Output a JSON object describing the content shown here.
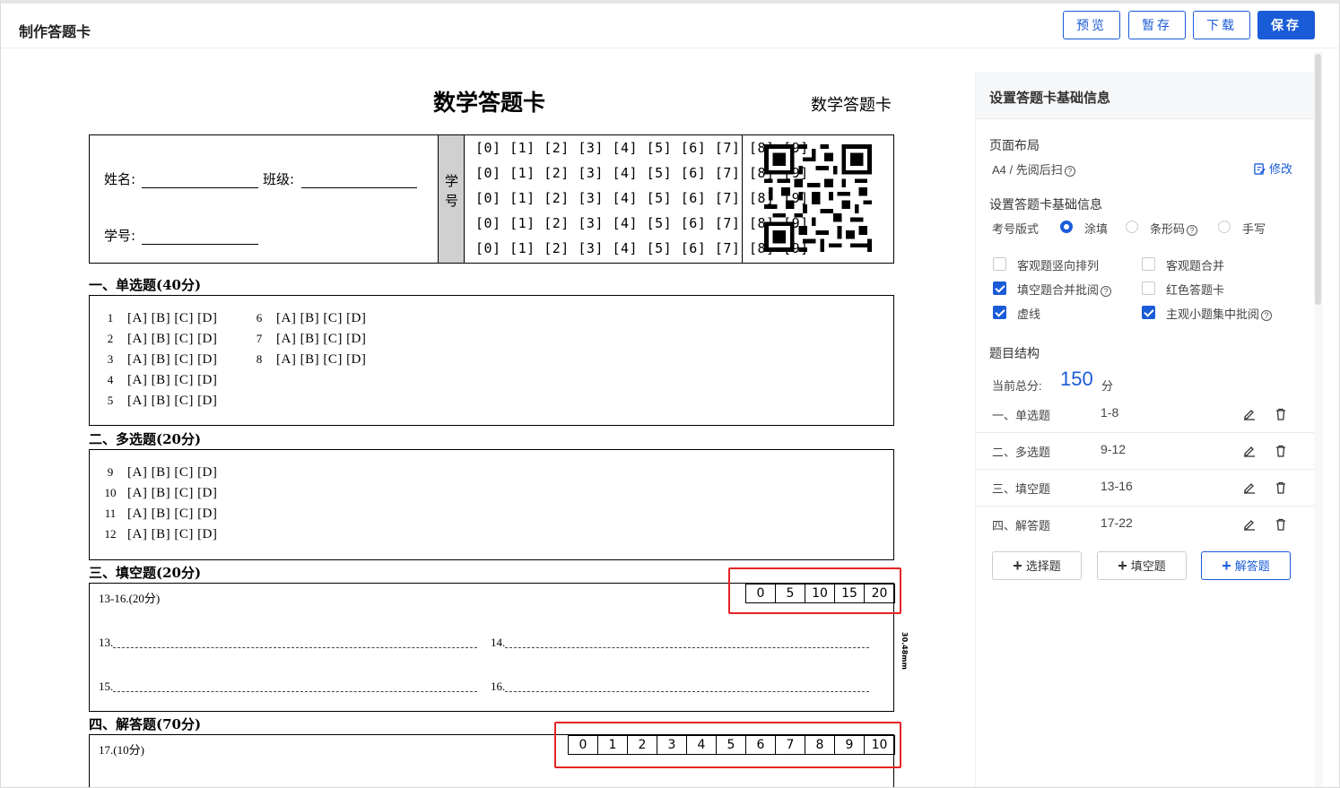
{
  "header": {
    "title": "制作答题卡",
    "buttons": {
      "preview": "预览",
      "draft": "暂存",
      "download": "下载",
      "save": "保存"
    }
  },
  "sheet": {
    "title": "数学答题卡",
    "subtitle": "数学答题卡",
    "info": {
      "name_label": "姓名:",
      "class_label": "班级:",
      "id_label": "学号:",
      "column_label": "学号",
      "digit_rows": [
        "[0] [1] [2] [3] [4] [5] [6] [7] [8] [9]",
        "[0] [1] [2] [3] [4] [5] [6] [7] [8] [9]",
        "[0] [1] [2] [3] [4] [5] [6] [7] [8] [9]",
        "[0] [1] [2] [3] [4] [5] [6] [7] [8] [9]",
        "[0] [1] [2] [3] [4] [5] [6] [7] [8] [9]"
      ]
    },
    "sections": {
      "single": {
        "title": "一、单选题(40分)",
        "options": "[A] [B] [C] [D]",
        "questions": [
          "1",
          "2",
          "3",
          "4",
          "5",
          "6",
          "7",
          "8"
        ]
      },
      "multi": {
        "title": "二、多选题(20分)",
        "options": "[A] [B] [C] [D]",
        "questions": [
          "9",
          "10",
          "11",
          "12"
        ]
      },
      "fill": {
        "title": "三、填空题(20分)",
        "subtitle": "13-16.(20分)",
        "scores": [
          "0",
          "5",
          "10",
          "15",
          "20"
        ],
        "blanks": [
          "13.",
          "14.",
          "15.",
          "16."
        ],
        "height_label": "30.48mm"
      },
      "answer": {
        "title": "四、解答题(70分)",
        "subtitle": "17.(10分)",
        "scores": [
          "0",
          "1",
          "2",
          "3",
          "4",
          "5",
          "6",
          "7",
          "8",
          "9",
          "10"
        ]
      }
    }
  },
  "sidebar": {
    "header": "设置答题卡基础信息",
    "layout": {
      "heading": "页面布局",
      "value": "A4 / 先阅后扫",
      "edit_label": "修改"
    },
    "basic": {
      "heading": "设置答题卡基础信息",
      "exam_id_label": "考号版式",
      "radios": [
        {
          "label": "涂填",
          "checked": true
        },
        {
          "label": "条形码",
          "checked": false
        },
        {
          "label": "手写",
          "checked": false
        }
      ],
      "checkboxes": [
        {
          "label": "客观题竖向排列",
          "checked": false
        },
        {
          "label": "客观题合并",
          "checked": false
        },
        {
          "label": "填空题合并批阅",
          "checked": true
        },
        {
          "label": "红色答题卡",
          "checked": false
        },
        {
          "label": "虚线",
          "checked": true
        },
        {
          "label": "主观小题集中批阅",
          "checked": true
        }
      ]
    },
    "structure": {
      "heading": "题目结构",
      "total_label": "当前总分:",
      "total_value": "150",
      "total_unit": "分",
      "rows": [
        {
          "name": "一、单选题",
          "range": "1-8"
        },
        {
          "name": "二、多选题",
          "range": "9-12"
        },
        {
          "name": "三、填空题",
          "range": "13-16"
        },
        {
          "name": "四、解答题",
          "range": "17-22"
        }
      ]
    },
    "add_buttons": {
      "choice": "选择题",
      "fill": "填空题",
      "answer": "解答题"
    }
  },
  "colors": {
    "accent": "#1a5bd8",
    "highlight": "#e52323"
  },
  "icons": [
    "help-icon",
    "edit-icon",
    "pencil-icon",
    "trash-icon",
    "plus-icon",
    "qr-code-icon"
  ]
}
